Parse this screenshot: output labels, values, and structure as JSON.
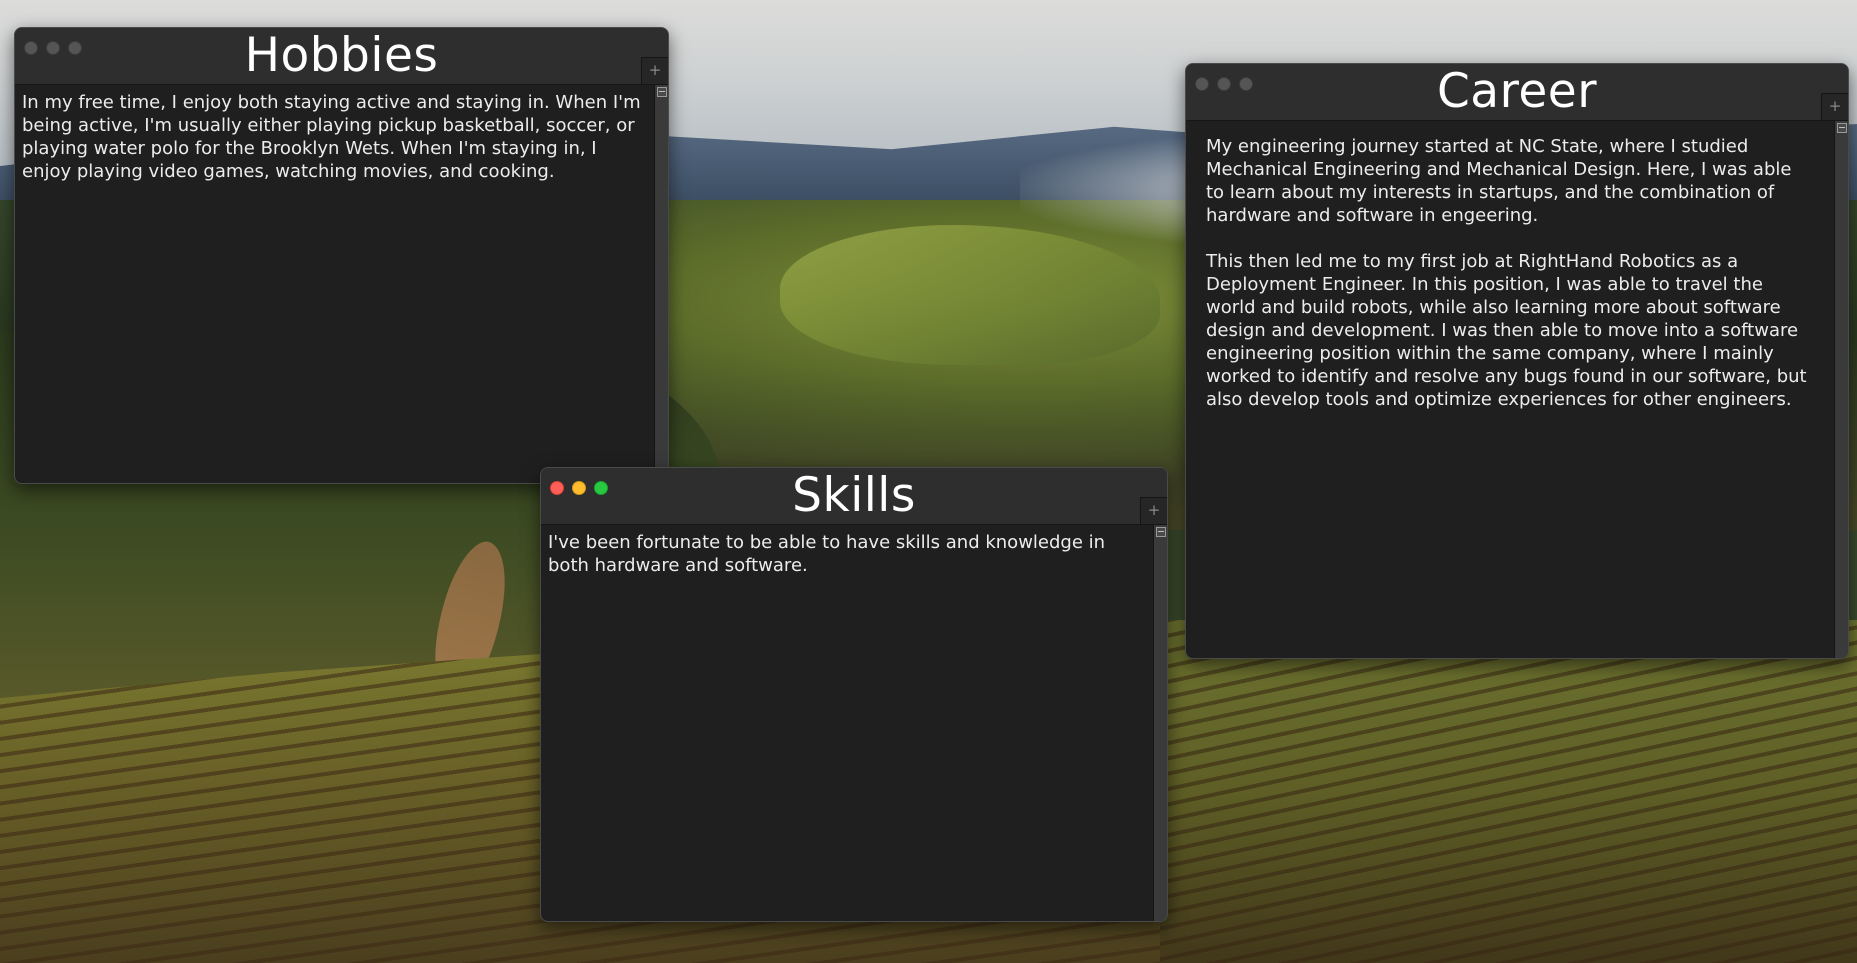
{
  "desktop": {
    "wallpaper": "forest-vineyard-landscape"
  },
  "windows": {
    "hobbies": {
      "title": "Hobbies",
      "active": false,
      "paragraphs": [
        "In my free time, I enjoy both staying active and staying in. When I'm being active, I'm usually either playing pickup basketball, soccer, or playing water polo for the Brooklyn Wets. When I'm staying in, I enjoy playing video games, watching movies, and cooking."
      ],
      "new_tab_label": "+"
    },
    "skills": {
      "title": "Skills",
      "active": true,
      "paragraphs": [
        "I've been fortunate to be able to have skills and knowledge in both hardware and software."
      ],
      "new_tab_label": "+"
    },
    "career": {
      "title": "Career",
      "active": false,
      "paragraphs": [
        "My engineering journey started at NC State, where I studied Mechanical Engineering and Mechanical Design. Here, I was able to learn about my interests in startups, and the combination of hardware and software in engeering.",
        "This then led me to my first job at RightHand Robotics as a Deployment Engineer. In this position, I was able to travel the world and build robots, while also learning more about software design and development. I was then able to move into a software engineering position within the same company, where I mainly worked to identify and resolve any bugs found in our software, but also develop tools and optimize experiences for other engineers."
      ],
      "new_tab_label": "+"
    }
  },
  "colors": {
    "window_bg": "#1f1f1f",
    "titlebar_bg": "#2e2e2e",
    "close": "#ff5f57",
    "minimize": "#febc2e",
    "maximize": "#28c840",
    "inactive_light": "#555555"
  }
}
